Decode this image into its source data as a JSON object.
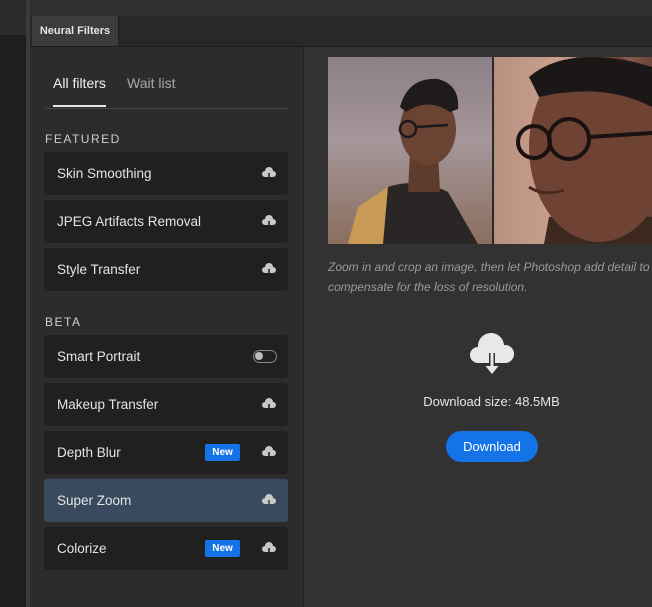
{
  "panel": {
    "tab_label": "Neural Filters"
  },
  "filter_tabs": {
    "all": "All filters",
    "wait": "Wait list"
  },
  "sections": {
    "featured": "FEATURED",
    "beta": "BETA"
  },
  "featured": [
    {
      "label": "Skin Smoothing",
      "icon": "cloud-download-icon"
    },
    {
      "label": "JPEG Artifacts Removal",
      "icon": "cloud-download-icon"
    },
    {
      "label": "Style Transfer",
      "icon": "cloud-download-icon"
    }
  ],
  "beta": [
    {
      "label": "Smart Portrait",
      "control": "toggle",
      "toggle_on": false
    },
    {
      "label": "Makeup Transfer",
      "icon": "cloud-download-icon"
    },
    {
      "label": "Depth Blur",
      "badge": "New",
      "icon": "cloud-download-icon"
    },
    {
      "label": "Super Zoom",
      "icon": "cloud-download-icon",
      "selected": true
    },
    {
      "label": "Colorize",
      "badge": "New",
      "icon": "cloud-download-icon"
    }
  ],
  "detail": {
    "description": "Zoom in and crop an image, then let Photoshop add detail to compensate for the loss of resolution.",
    "download_size": "Download size: 48.5MB",
    "download_label": "Download"
  },
  "colors": {
    "accent": "#1473e6",
    "selected_bg": "#3a4a5e",
    "item_bg": "#202020"
  }
}
